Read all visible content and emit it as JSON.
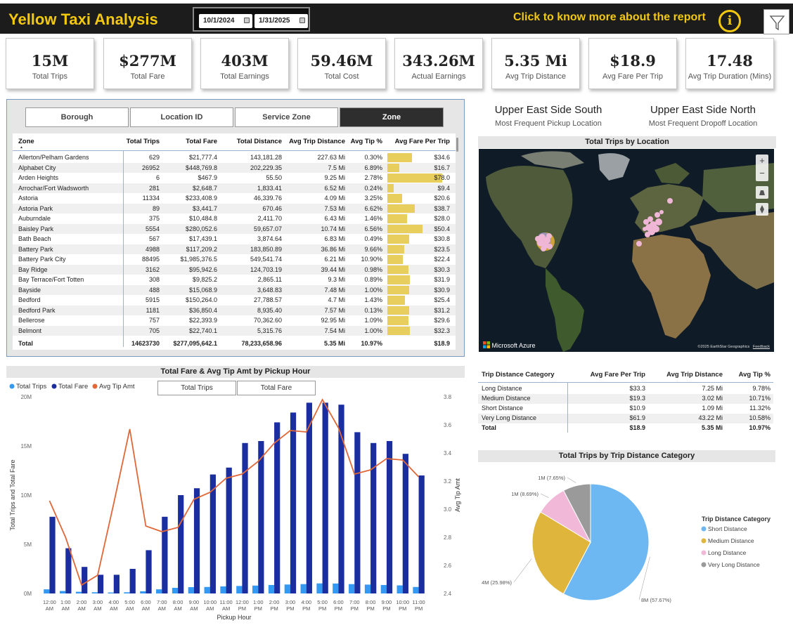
{
  "app": {
    "title": "Yellow Taxi Analysis",
    "about_label": "Click to know more about the report",
    "info_glyph": "i"
  },
  "dates": {
    "start": "10/1/2024",
    "end": "1/31/2025"
  },
  "kpis": [
    {
      "value": "15M",
      "label": "Total Trips"
    },
    {
      "value": "$277M",
      "label": "Total Fare"
    },
    {
      "value": "403M",
      "label": "Total Earnings"
    },
    {
      "value": "59.46M",
      "label": "Total Cost"
    },
    {
      "value": "343.26M",
      "label": "Actual Earnings"
    },
    {
      "value": "5.35 Mi",
      "label": "Avg Trip Distance"
    },
    {
      "value": "$18.9",
      "label": "Avg Fare Per Trip"
    },
    {
      "value": "17.48",
      "label": "Avg Trip Duration (Mins)"
    }
  ],
  "tabs": [
    "Borough",
    "Location ID",
    "Service Zone",
    "Zone"
  ],
  "zone_table": {
    "headers": [
      "Zone",
      "Total Trips",
      "Total Fare",
      "Total Distance",
      "Avg Trip Distance",
      "Avg Tip %",
      "Avg Fare Per Trip"
    ],
    "sort_glyph": "▲",
    "rows": [
      {
        "zone": "Allerton/Pelham Gardens",
        "trips": "629",
        "fare": "$21,777.4",
        "distance": "143,181.28",
        "avg_dist": "227.63 Mi",
        "tip": "0.30%",
        "fpt": "$34.6",
        "fpt_value": 34.6
      },
      {
        "zone": "Alphabet City",
        "trips": "26952",
        "fare": "$448,769.8",
        "distance": "202,229.35",
        "avg_dist": "7.5 Mi",
        "tip": "6.89%",
        "fpt": "$16.7",
        "fpt_value": 16.7
      },
      {
        "zone": "Arden Heights",
        "trips": "6",
        "fare": "$467.9",
        "distance": "55.50",
        "avg_dist": "9.25 Mi",
        "tip": "2.78%",
        "fpt": "$78.0",
        "fpt_value": 78.0
      },
      {
        "zone": "Arrochar/Fort Wadsworth",
        "trips": "281",
        "fare": "$2,648.7",
        "distance": "1,833.41",
        "avg_dist": "6.52 Mi",
        "tip": "0.24%",
        "fpt": "$9.4",
        "fpt_value": 9.4
      },
      {
        "zone": "Astoria",
        "trips": "11334",
        "fare": "$233,408.9",
        "distance": "46,339.76",
        "avg_dist": "4.09 Mi",
        "tip": "3.25%",
        "fpt": "$20.6",
        "fpt_value": 20.6
      },
      {
        "zone": "Astoria Park",
        "trips": "89",
        "fare": "$3,441.7",
        "distance": "670.46",
        "avg_dist": "7.53 Mi",
        "tip": "6.62%",
        "fpt": "$38.7",
        "fpt_value": 38.7
      },
      {
        "zone": "Auburndale",
        "trips": "375",
        "fare": "$10,484.8",
        "distance": "2,411.70",
        "avg_dist": "6.43 Mi",
        "tip": "1.46%",
        "fpt": "$28.0",
        "fpt_value": 28.0
      },
      {
        "zone": "Baisley Park",
        "trips": "5554",
        "fare": "$280,052.6",
        "distance": "59,657.07",
        "avg_dist": "10.74 Mi",
        "tip": "6.56%",
        "fpt": "$50.4",
        "fpt_value": 50.4
      },
      {
        "zone": "Bath Beach",
        "trips": "567",
        "fare": "$17,439.1",
        "distance": "3,874.64",
        "avg_dist": "6.83 Mi",
        "tip": "0.49%",
        "fpt": "$30.8",
        "fpt_value": 30.8
      },
      {
        "zone": "Battery Park",
        "trips": "4988",
        "fare": "$117,209.2",
        "distance": "183,850.89",
        "avg_dist": "36.86 Mi",
        "tip": "9.66%",
        "fpt": "$23.5",
        "fpt_value": 23.5
      },
      {
        "zone": "Battery Park City",
        "trips": "88495",
        "fare": "$1,985,376.5",
        "distance": "549,541.74",
        "avg_dist": "6.21 Mi",
        "tip": "10.90%",
        "fpt": "$22.4",
        "fpt_value": 22.4
      },
      {
        "zone": "Bay Ridge",
        "trips": "3162",
        "fare": "$95,942.6",
        "distance": "124,703.19",
        "avg_dist": "39.44 Mi",
        "tip": "0.98%",
        "fpt": "$30.3",
        "fpt_value": 30.3
      },
      {
        "zone": "Bay Terrace/Fort Totten",
        "trips": "308",
        "fare": "$9,825.2",
        "distance": "2,865.11",
        "avg_dist": "9.3 Mi",
        "tip": "0.89%",
        "fpt": "$31.9",
        "fpt_value": 31.9
      },
      {
        "zone": "Bayside",
        "trips": "488",
        "fare": "$15,068.9",
        "distance": "3,648.83",
        "avg_dist": "7.48 Mi",
        "tip": "1.00%",
        "fpt": "$30.9",
        "fpt_value": 30.9
      },
      {
        "zone": "Bedford",
        "trips": "5915",
        "fare": "$150,264.0",
        "distance": "27,788.57",
        "avg_dist": "4.7 Mi",
        "tip": "1.43%",
        "fpt": "$25.4",
        "fpt_value": 25.4
      },
      {
        "zone": "Bedford Park",
        "trips": "1181",
        "fare": "$36,850.4",
        "distance": "8,935.40",
        "avg_dist": "7.57 Mi",
        "tip": "0.13%",
        "fpt": "$31.2",
        "fpt_value": 31.2
      },
      {
        "zone": "Bellerose",
        "trips": "757",
        "fare": "$22,393.9",
        "distance": "70,362.60",
        "avg_dist": "92.95 Mi",
        "tip": "1.09%",
        "fpt": "$29.6",
        "fpt_value": 29.6
      },
      {
        "zone": "Belmont",
        "trips": "705",
        "fare": "$22,740.1",
        "distance": "5,315.76",
        "avg_dist": "7.54 Mi",
        "tip": "1.00%",
        "fpt": "$32.3",
        "fpt_value": 32.3
      }
    ],
    "total": {
      "zone": "Total",
      "trips": "14623730",
      "fare": "$277,095,642.1",
      "distance": "78,233,658.96",
      "avg_dist": "5.35 Mi",
      "tip": "10.97%",
      "fpt": "$18.9"
    }
  },
  "locations": {
    "pickup": {
      "name": "Upper East Side South",
      "label": "Most Frequent Pickup Location"
    },
    "dropoff": {
      "name": "Upper East Side North",
      "label": "Most Frequent Dropoff Location"
    }
  },
  "map": {
    "title": "Total Trips by Location",
    "brand": "Microsoft Azure",
    "credit": "©2025 EarthStar Geographics",
    "feedback": "Feedback",
    "controls": [
      "+",
      "−"
    ]
  },
  "hour_chart": {
    "title": "Total Fare & Avg Tip Amt by Pickup Hour",
    "toggle_buttons": [
      "Total Trips",
      "Total Fare"
    ]
  },
  "dist_table": {
    "headers": [
      "Trip Distance Category",
      "Avg Fare Per Trip",
      "Avg Trip Distance",
      "Avg Tip %"
    ],
    "rows": [
      [
        "Long Distance",
        "$33.3",
        "7.25 Mi",
        "9.78%"
      ],
      [
        "Medium Distance",
        "$19.3",
        "3.02 Mi",
        "10.71%"
      ],
      [
        "Short Distance",
        "$10.9",
        "1.09 Mi",
        "11.32%"
      ],
      [
        "Very Long Distance",
        "$61.9",
        "43.22 Mi",
        "10.58%"
      ]
    ],
    "total": [
      "Total",
      "$18.9",
      "5.35 Mi",
      "10.97%"
    ]
  },
  "chart_data": [
    {
      "type": "bar",
      "title": "Total Fare & Avg Tip Amt by Pickup Hour",
      "xlabel": "Pickup Hour",
      "ylabel": "Total Trips and Total Fare",
      "y2label": "Avg Tip Amt",
      "categories": [
        "12:00 AM",
        "1:00 AM",
        "2:00 AM",
        "3:00 AM",
        "4:00 AM",
        "5:00 AM",
        "6:00 AM",
        "7:00 AM",
        "8:00 AM",
        "9:00 AM",
        "10:00 AM",
        "11:00 AM",
        "12:00 PM",
        "1:00 PM",
        "2:00 PM",
        "3:00 PM",
        "4:00 PM",
        "5:00 PM",
        "6:00 PM",
        "7:00 PM",
        "8:00 PM",
        "9:00 PM",
        "10:00 PM",
        "11:00 PM"
      ],
      "series": [
        {
          "name": "Total Trips",
          "color": "#3399f3",
          "axis": "left",
          "kind": "bar",
          "values": [
            0.42,
            0.25,
            0.17,
            0.12,
            0.1,
            0.12,
            0.22,
            0.42,
            0.57,
            0.64,
            0.66,
            0.72,
            0.76,
            0.8,
            0.86,
            0.91,
            0.95,
            1.02,
            1.01,
            0.95,
            0.9,
            0.86,
            0.82,
            0.66
          ]
        },
        {
          "name": "Total Fare",
          "color": "#1a2ea0",
          "axis": "left",
          "kind": "bar",
          "values": [
            7.8,
            4.6,
            2.7,
            1.9,
            1.9,
            2.5,
            4.4,
            7.8,
            10.0,
            10.7,
            12.1,
            12.8,
            15.3,
            15.5,
            17.4,
            18.4,
            19.4,
            19.4,
            19.2,
            16.4,
            15.3,
            15.5,
            14.2,
            12.0
          ]
        },
        {
          "name": "Avg Tip Amt",
          "color": "#e06838",
          "axis": "right",
          "kind": "line",
          "values": [
            3.06,
            2.8,
            2.46,
            2.53,
            3.04,
            3.57,
            2.88,
            2.84,
            2.87,
            3.07,
            3.12,
            3.22,
            3.25,
            3.34,
            3.47,
            3.56,
            3.55,
            3.78,
            3.58,
            3.25,
            3.28,
            3.36,
            3.35,
            3.23
          ]
        }
      ],
      "ylim": [
        0,
        20
      ],
      "y_unit": "M",
      "yticks": [
        "0M",
        "5M",
        "10M",
        "15M",
        "20M"
      ],
      "y2lim": [
        2.4,
        3.8
      ],
      "y2ticks": [
        "2.4",
        "2.6",
        "2.8",
        "3.0",
        "3.2",
        "3.4",
        "3.6",
        "3.8"
      ],
      "legend": "top-left"
    },
    {
      "type": "pie",
      "title": "Total Trips by Trip Distance Category",
      "legend_title": "Trip Distance Category",
      "legend": "right",
      "slices": [
        {
          "name": "Short Distance",
          "value": 57.67,
          "label": "8M (57.67%)",
          "color": "#6db8f2"
        },
        {
          "name": "Medium Distance",
          "value": 25.98,
          "label": "4M (25.98%)",
          "color": "#e0b53c"
        },
        {
          "name": "Long Distance",
          "value": 8.69,
          "label": "1M (8.69%)",
          "color": "#f1b8d8"
        },
        {
          "name": "Very Long Distance",
          "value": 7.65,
          "label": "1M (7.65%)",
          "color": "#9a9a9a"
        }
      ]
    }
  ]
}
